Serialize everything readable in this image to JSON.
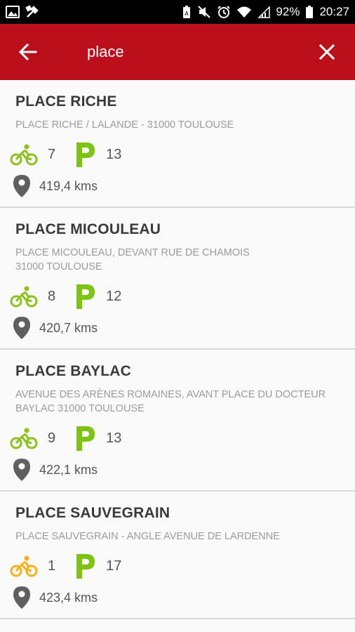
{
  "status_bar": {
    "battery": "92%",
    "time": "20:27"
  },
  "search": {
    "value": "place",
    "back_icon": "arrow-left-icon",
    "clear_icon": "close-icon"
  },
  "colors": {
    "app_bar": "#bb0f1b",
    "bike_green": "#8cc21f",
    "bike_orange": "#f4b21e",
    "parking_green": "#7cc314",
    "pin_gray": "#5f5f5f"
  },
  "stations": [
    {
      "name": "PLACE RICHE",
      "address": "PLACE RICHE / LALANDE - 31000 TOULOUSE",
      "bikes": "7",
      "bike_status": "green",
      "stands": "13",
      "distance": "419,4 kms"
    },
    {
      "name": "PLACE MICOULEAU",
      "address": "PLACE MICOULEAU, DEVANT RUE DE CHAMOIS\n31000 TOULOUSE",
      "bikes": "8",
      "bike_status": "green",
      "stands": "12",
      "distance": "420,7 kms"
    },
    {
      "name": "PLACE BAYLAC",
      "address": "AVENUE DES ARÈNES ROMAINES, AVANT PLACE DU DOCTEUR BAYLAC 31000 TOULOUSE",
      "bikes": "9",
      "bike_status": "green",
      "stands": "13",
      "distance": "422,1 kms"
    },
    {
      "name": "PLACE SAUVEGRAIN",
      "address": "PLACE SAUVEGRAIN - ANGLE AVENUE DE LARDENNE",
      "bikes": "1",
      "bike_status": "orange",
      "stands": "17",
      "distance": "423,4 kms"
    }
  ]
}
